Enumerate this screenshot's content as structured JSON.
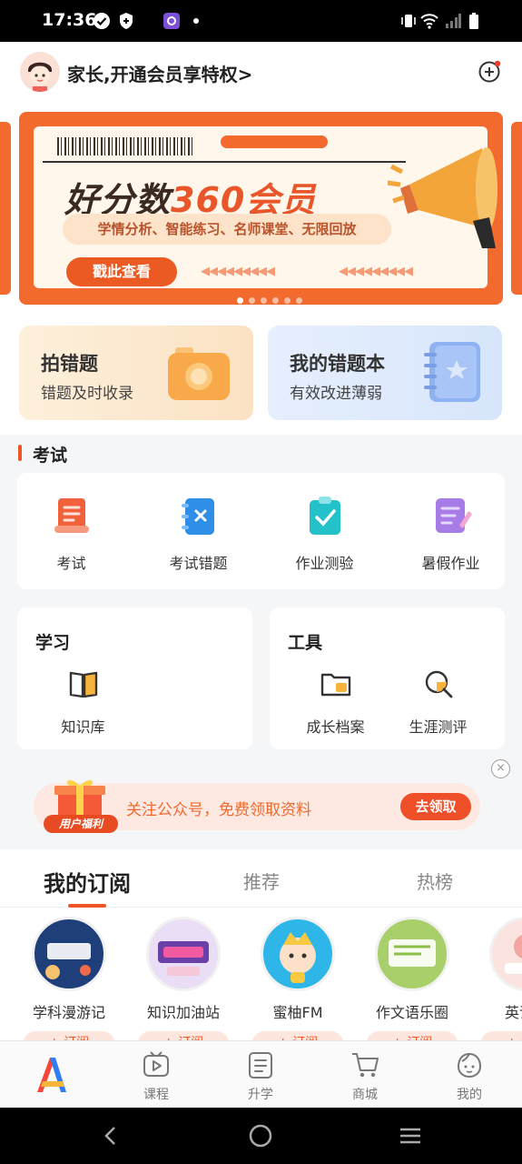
{
  "status_bar": {
    "time": "17:36"
  },
  "header": {
    "title": "家长,开通会员享特权>"
  },
  "banner": {
    "title_part1": "好分数",
    "title_part2": "360会员",
    "subtitle": "学情分析、智能练习、名师课堂、无限回放",
    "button": "戳此查看",
    "page_count": 6,
    "active_page": 1
  },
  "quick_cards": [
    {
      "title": "拍错题",
      "subtitle": "错题及时收录",
      "icon": "camera-icon"
    },
    {
      "title": "我的错题本",
      "subtitle": "有效改进薄弱",
      "icon": "notebook-icon"
    }
  ],
  "exam_section": {
    "title": "考试",
    "items": [
      {
        "label": "考试",
        "icon": "exam-scroll-icon"
      },
      {
        "label": "考试错题",
        "icon": "exam-error-book-icon"
      },
      {
        "label": "作业测验",
        "icon": "homework-check-icon"
      },
      {
        "label": "暑假作业",
        "icon": "summer-homework-icon"
      }
    ]
  },
  "study_card": {
    "title": "学习",
    "items": [
      {
        "label": "知识库",
        "icon": "book-icon"
      }
    ]
  },
  "tools_card": {
    "title": "工具",
    "items": [
      {
        "label": "成长档案",
        "icon": "folder-icon"
      },
      {
        "label": "生涯测评",
        "icon": "magnifier-icon"
      }
    ]
  },
  "promo": {
    "badge": "用户福利",
    "text": "关注公众号，免费领取资料",
    "button": "去领取",
    "close": "×"
  },
  "feed_tabs": [
    {
      "label": "我的订阅",
      "active": true
    },
    {
      "label": "推荐",
      "active": false
    },
    {
      "label": "热榜",
      "active": false
    }
  ],
  "subscriptions": [
    {
      "label": "学科漫游记",
      "button": "+ 订阅",
      "color": "#1f3f7a"
    },
    {
      "label": "知识加油站",
      "button": "+ 订阅",
      "color": "#6a3fa8"
    },
    {
      "label": "蜜柚FM",
      "button": "+ 订阅",
      "color": "#2fb6e8"
    },
    {
      "label": "作文语乐圈",
      "button": "+ 订阅",
      "color": "#a9cf6a"
    },
    {
      "label": "英语畅",
      "button": "+ 订阅",
      "color": "#f1a6a0"
    }
  ],
  "tab_bar": [
    {
      "label": "",
      "icon": "app-logo-icon"
    },
    {
      "label": "课程",
      "icon": "tv-icon"
    },
    {
      "label": "升学",
      "icon": "document-icon"
    },
    {
      "label": "商城",
      "icon": "cart-icon"
    },
    {
      "label": "我的",
      "icon": "face-icon"
    }
  ],
  "colors": {
    "accent": "#ef5627",
    "banner": "#f26a2e",
    "page_bg": "#f5f6f8"
  }
}
